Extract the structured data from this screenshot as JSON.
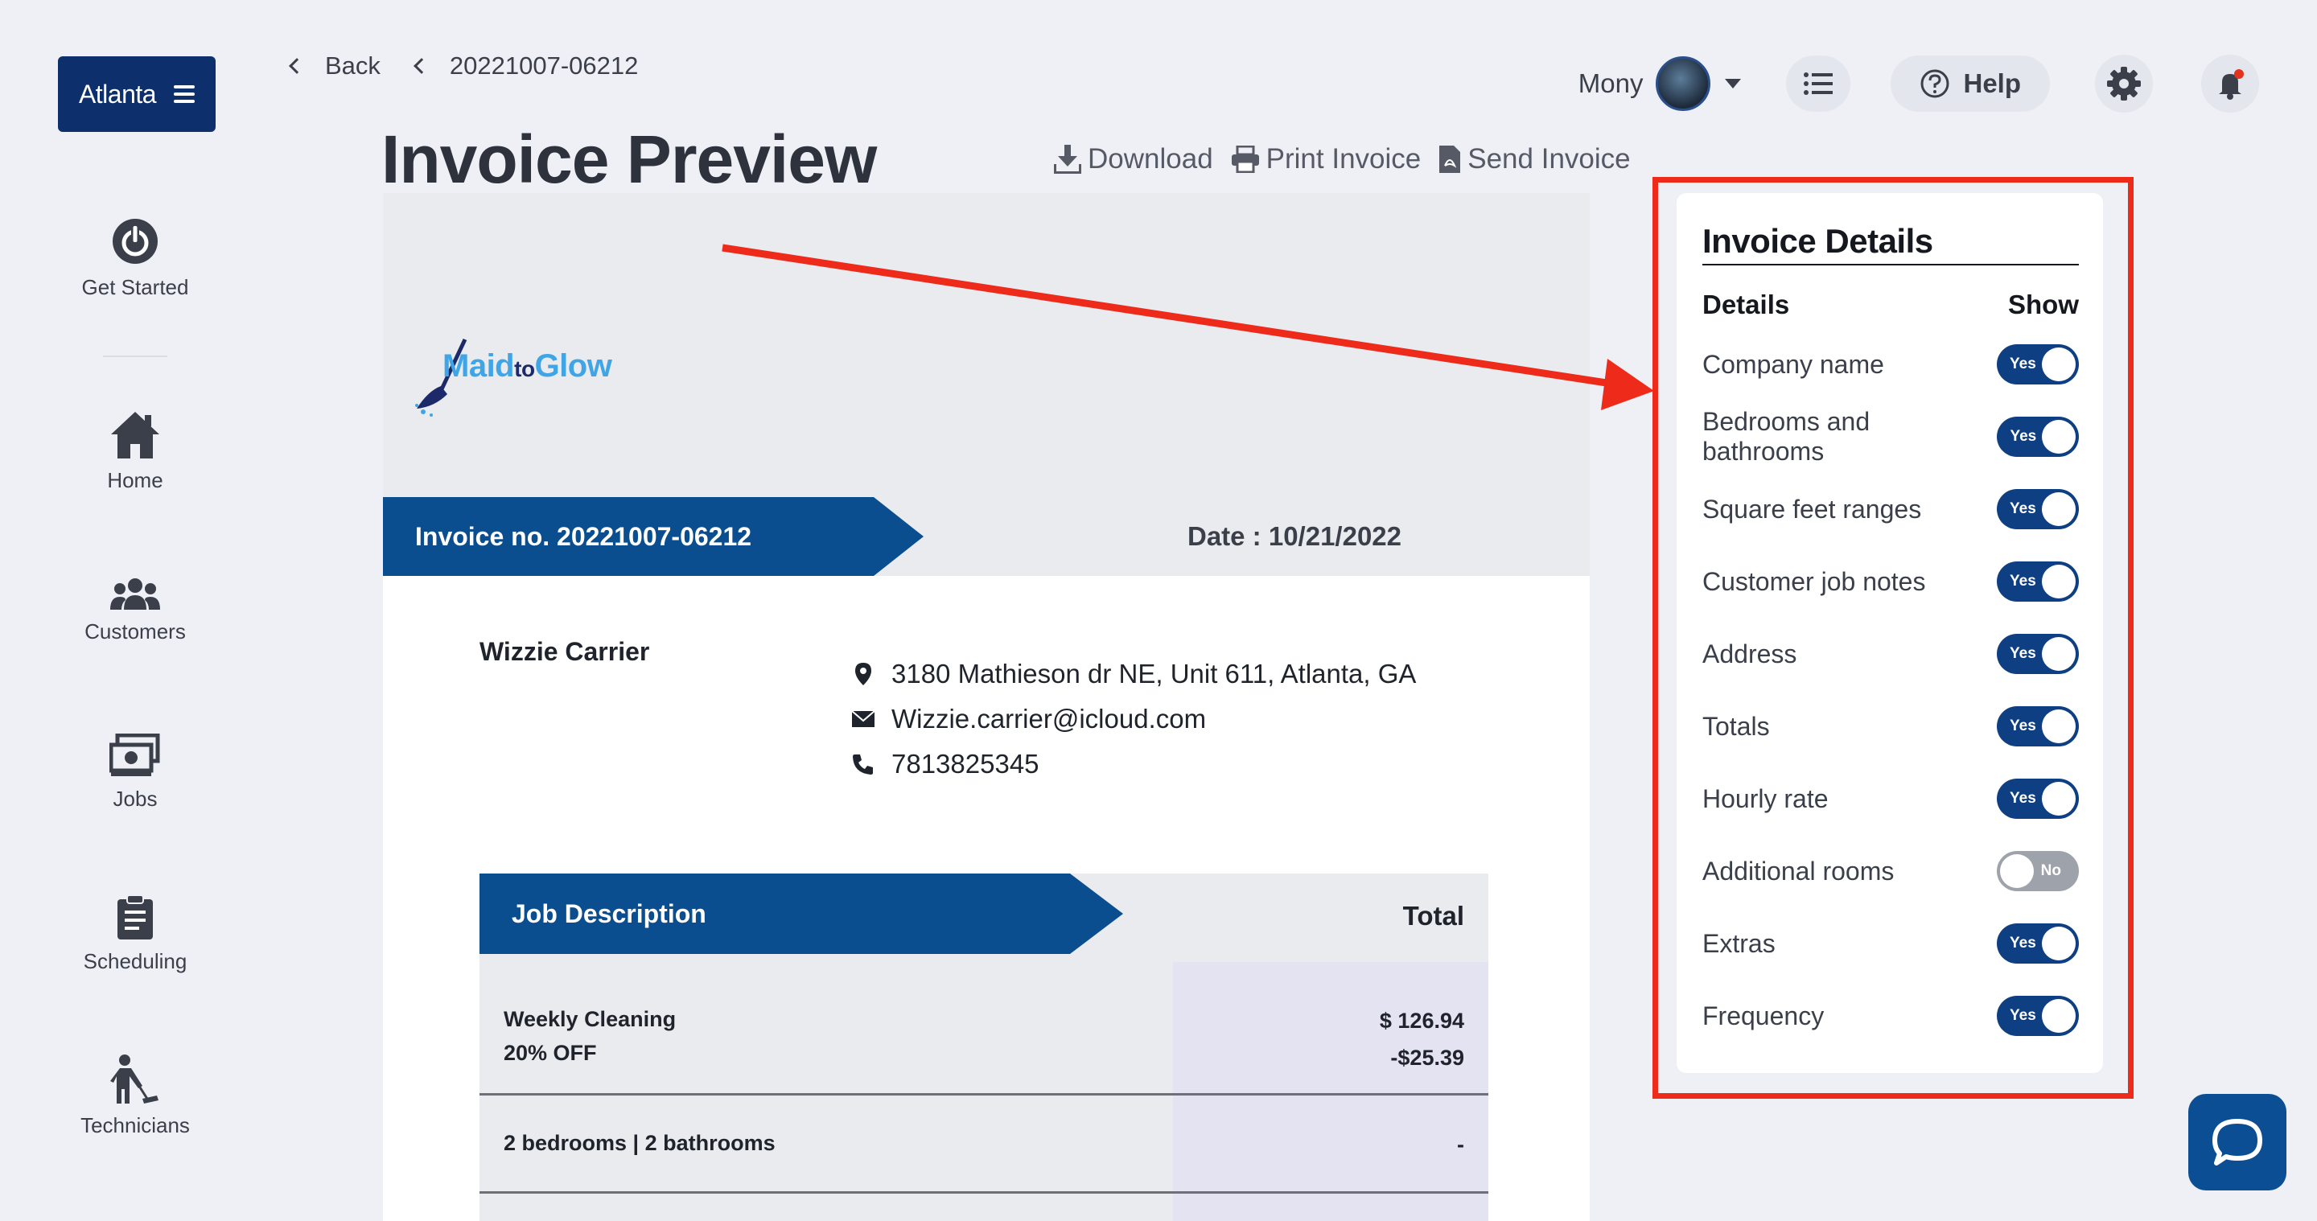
{
  "sidebar": {
    "city": "Atlanta",
    "items": [
      {
        "label": "Get Started",
        "icon": "power-icon"
      },
      {
        "label": "Home",
        "icon": "home-icon"
      },
      {
        "label": "Customers",
        "icon": "users-icon"
      },
      {
        "label": "Jobs",
        "icon": "cash-icon"
      },
      {
        "label": "Scheduling",
        "icon": "clipboard-icon"
      },
      {
        "label": "Technicians",
        "icon": "cleaner-icon"
      }
    ]
  },
  "breadcrumb": {
    "back": "Back",
    "current": "20221007-06212"
  },
  "page": {
    "title": "Invoice Preview"
  },
  "actions": {
    "download": "Download",
    "print": "Print Invoice",
    "send": "Send Invoice"
  },
  "topbar": {
    "user": "Mony",
    "help": "Help"
  },
  "invoice": {
    "logo_main": "Maid",
    "logo_to": "to",
    "logo_glow": "Glow",
    "number_label": "Invoice no. 20221007-06212",
    "date_label": "Date : 10/21/2022",
    "customer": "Wizzie Carrier",
    "address": "3180 Mathieson dr NE, Unit 611, Atlanta, GA",
    "email": "Wizzie.carrier@icloud.com",
    "phone": "7813825345",
    "job_description_header": "Job Description",
    "total_header": "Total",
    "rows": [
      {
        "line1": "Weekly Cleaning",
        "line2": "20% OFF",
        "amount1": "$ 126.94",
        "amount2": "-$25.39"
      },
      {
        "line1": "2 bedrooms | 2 bathrooms",
        "amount1": "-"
      }
    ]
  },
  "details_panel": {
    "title": "Invoice Details",
    "col_details": "Details",
    "col_show": "Show",
    "options": [
      {
        "label": "Company name",
        "state": "Yes"
      },
      {
        "label": "Bedrooms and bathrooms",
        "state": "Yes"
      },
      {
        "label": "Square feet ranges",
        "state": "Yes"
      },
      {
        "label": "Customer job notes",
        "state": "Yes"
      },
      {
        "label": "Address",
        "state": "Yes"
      },
      {
        "label": "Totals",
        "state": "Yes"
      },
      {
        "label": "Hourly rate",
        "state": "Yes"
      },
      {
        "label": "Additional rooms",
        "state": "No"
      },
      {
        "label": "Extras",
        "state": "Yes"
      },
      {
        "label": "Frequency",
        "state": "Yes"
      }
    ]
  },
  "colors": {
    "brand_navy": "#0d2f6b",
    "banner_blue": "#0a4e8f",
    "annotation_red": "#ee2b1b",
    "logo_blue": "#3fa5e6"
  }
}
